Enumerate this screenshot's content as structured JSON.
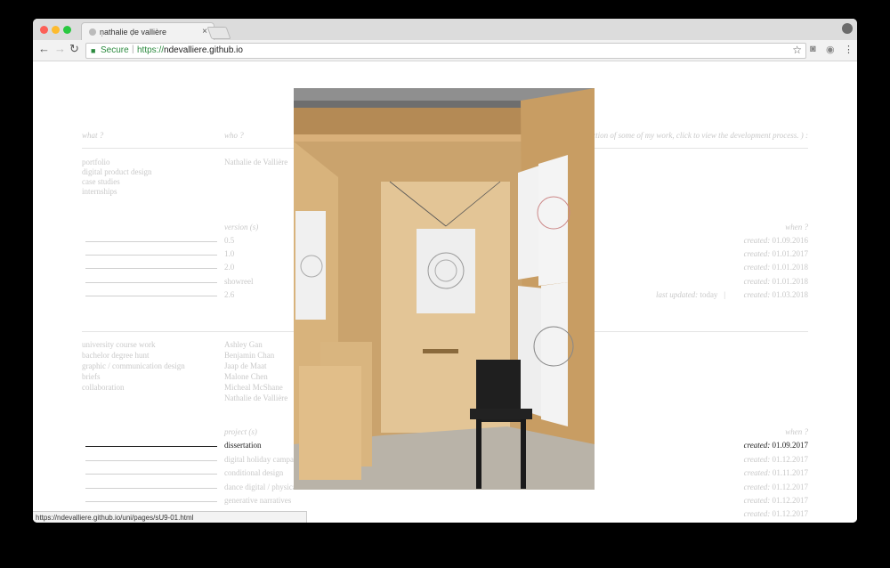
{
  "browser": {
    "tab_title": "ṇathalie ḍe vallière",
    "secure_label": "Secure",
    "url_scheme": "https://",
    "url_host": "ndevalliere.github.io",
    "status_url": "https://ndevalliere.github.io/uni/pages/sU9-01.html",
    "back_glyph": "←",
    "forward_glyph": "→",
    "reload_glyph": "↻",
    "close_glyph": "×",
    "star_glyph": "☆",
    "menu_glyph": "⋮",
    "icons": [
      "back-arrow-icon",
      "forward-arrow-icon",
      "reload-icon",
      "lock-icon",
      "star-icon",
      "camera-icon",
      "extension-icon",
      "menu-icon",
      "account-icon"
    ]
  },
  "page": {
    "headers": {
      "what": "what ?",
      "who": "who ?",
      "note": "( a selection of some of my work, click to view the development process. ) :"
    },
    "what_items": [
      "portfolio",
      "digital product design",
      "case studies",
      "internships"
    ],
    "who_name": "Nathalie de Vallière",
    "version_header": "version (s)",
    "when_header": "when ?",
    "versions": [
      {
        "version": "0.5",
        "created_label": "created:",
        "date": "01.09.2016"
      },
      {
        "version": "1.0",
        "created_label": "created:",
        "date": "01.01.2017"
      },
      {
        "version": "2.0",
        "created_label": "created:",
        "date": "01.01.2018"
      },
      {
        "version": "showreel",
        "created_label": "created:",
        "date": "01.01.2018"
      },
      {
        "version": "2.6",
        "created_label": "created:",
        "date": "01.03.2018"
      }
    ],
    "last_updated_label": "last updated:",
    "last_updated_value": "today",
    "last_updated_sep": "|",
    "context_items": [
      "university course work",
      "bachelor degree hunt",
      "graphic / communication design",
      "briefs",
      "collaboration"
    ],
    "people": [
      "Ashley Gan",
      "Benjamin Chan",
      "Jaap de Maat",
      "Malone Chen",
      "Micheal McShane",
      "Nathalie de Vallière"
    ],
    "project_header": "project (s)",
    "projects": [
      {
        "name": "dissertation",
        "created_label": "created:",
        "date": "01.09.2017",
        "active": true
      },
      {
        "name": "digital holiday campaign",
        "created_label": "created:",
        "date": "01.12.2017",
        "active": false
      },
      {
        "name": "conditional design",
        "created_label": "created:",
        "date": "01.11.2017",
        "active": false
      },
      {
        "name": "dance digital / physical",
        "created_label": "created:",
        "date": "01.12.2017",
        "active": false
      },
      {
        "name": "generative narratives",
        "created_label": "created:",
        "date": "01.12.2017",
        "active": false
      },
      {
        "name": "",
        "created_label": "created:",
        "date": "01.12.2017",
        "active": false
      }
    ]
  },
  "photo": {
    "subject": "wooden-booth-photo"
  },
  "colors": {
    "secure_green": "#2b8a3e",
    "text_faded": "#c9c9c9",
    "text_dark": "#222222",
    "wood": "#c9a26c"
  }
}
